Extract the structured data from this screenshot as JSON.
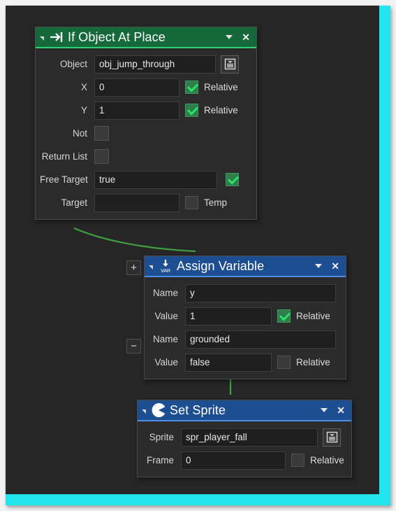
{
  "theme": {
    "accent_border": "#23e5ee",
    "canvas_bg": "#262626",
    "panel_bg": "#2b2b2b",
    "green_header": "#15693a",
    "blue_header": "#1e4e92",
    "connector_green": "#3f9e3f",
    "check_green": "#2ee06a"
  },
  "nodes": [
    {
      "id": "if-object-at-place",
      "title": "If Object At Place",
      "icon": "arrow-to-bar-icon",
      "header_color": "green",
      "collapse_icon": "collapse-triangle-icon",
      "menu_icon": "chevron-down-icon",
      "close_icon": "close-icon",
      "rows": [
        {
          "label": "Object",
          "value": "obj_jump_through",
          "list_button": true
        },
        {
          "label": "X",
          "value": "0",
          "checkbox": true,
          "checkbox_label": "Relative"
        },
        {
          "label": "Y",
          "value": "1",
          "checkbox": true,
          "checkbox_label": "Relative"
        },
        {
          "label": "Not",
          "checkbox_only": true,
          "checkbox": false
        },
        {
          "label": "Return List",
          "checkbox_only": true,
          "checkbox": false
        },
        {
          "label": "Free Target",
          "value": "true",
          "checkbox": true,
          "checkbox_label": ""
        },
        {
          "label": "Target",
          "value": "",
          "checkbox": false,
          "checkbox_label": "Temp"
        }
      ]
    },
    {
      "id": "assign-variable",
      "title": "Assign Variable",
      "icon": "var-down-arrow-icon",
      "icon_text": "VAR",
      "header_color": "blue",
      "collapse_icon": "collapse-triangle-icon",
      "menu_icon": "chevron-down-icon",
      "close_icon": "close-icon",
      "add_button": "+",
      "remove_button": "−",
      "rows": [
        {
          "label": "Name",
          "value": "y"
        },
        {
          "label": "Value",
          "value": "1",
          "checkbox": true,
          "checkbox_label": "Relative"
        },
        {
          "label": "Name",
          "value": "grounded"
        },
        {
          "label": "Value",
          "value": "false",
          "checkbox": false,
          "checkbox_label": "Relative"
        }
      ]
    },
    {
      "id": "set-sprite",
      "title": "Set Sprite",
      "icon": "pacman-sprite-icon",
      "header_color": "blue",
      "collapse_icon": "collapse-triangle-icon",
      "menu_icon": "chevron-down-icon",
      "close_icon": "close-icon",
      "rows": [
        {
          "label": "Sprite",
          "value": "spr_player_fall",
          "list_button": true
        },
        {
          "label": "Frame",
          "value": "0",
          "checkbox": false,
          "checkbox_label": "Relative"
        }
      ]
    }
  ]
}
